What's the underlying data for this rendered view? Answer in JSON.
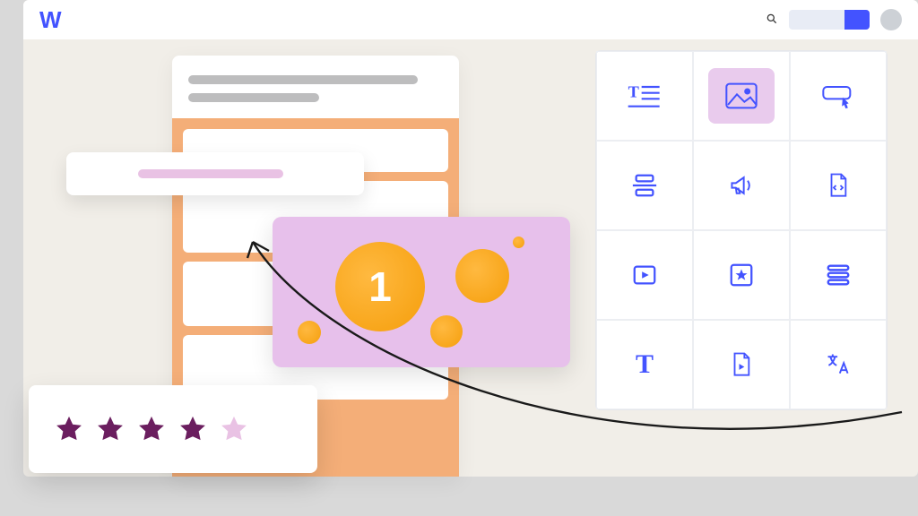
{
  "header": {
    "logo": "W"
  },
  "preview": {
    "number_label": "1"
  },
  "rating": {
    "filled_stars": 4,
    "total_stars": 5
  },
  "colors": {
    "primary": "#4353ff",
    "accent_orange": "#f59e0b",
    "accent_pink": "#e7c0eb",
    "star_filled": "#6b1e5f",
    "star_empty": "#e9c2e4"
  },
  "component_panel": {
    "items": [
      {
        "id": "text-block",
        "icon": "text-lines",
        "selected": false
      },
      {
        "id": "image",
        "icon": "image",
        "selected": true
      },
      {
        "id": "button",
        "icon": "button",
        "selected": false
      },
      {
        "id": "divider",
        "icon": "align-center",
        "selected": false
      },
      {
        "id": "announcement",
        "icon": "megaphone",
        "selected": false
      },
      {
        "id": "code-file",
        "icon": "code-file",
        "selected": false
      },
      {
        "id": "video",
        "icon": "play-box",
        "selected": false
      },
      {
        "id": "featured",
        "icon": "star-box",
        "selected": false
      },
      {
        "id": "list",
        "icon": "list-rows",
        "selected": false
      },
      {
        "id": "heading",
        "icon": "heading",
        "selected": false
      },
      {
        "id": "media-file",
        "icon": "media-file",
        "selected": false
      },
      {
        "id": "translate",
        "icon": "translate",
        "selected": false
      }
    ]
  }
}
